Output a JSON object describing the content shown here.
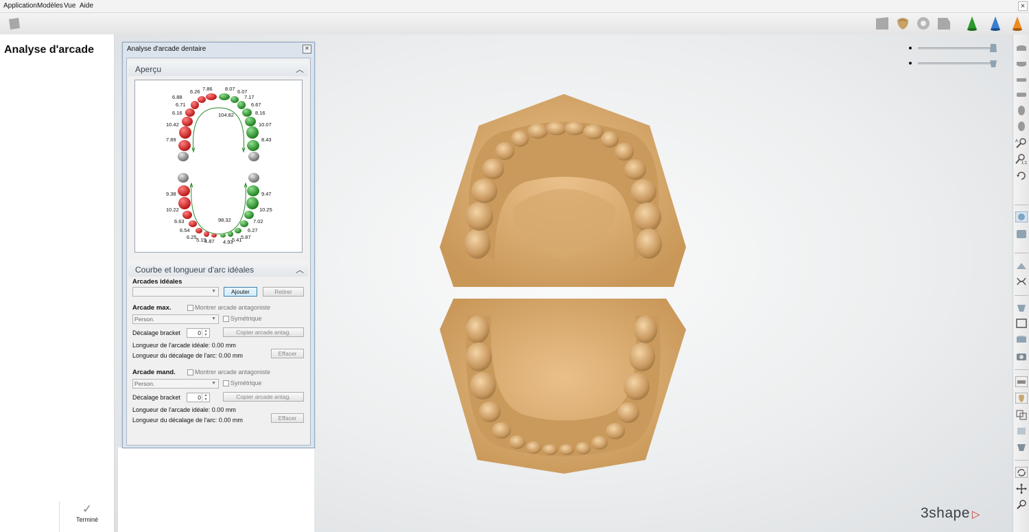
{
  "menu": {
    "items": [
      "Application",
      "Modèles",
      "Vue",
      "Aide"
    ]
  },
  "left_panel": {
    "title": "Analyse d'arcade",
    "done_label": "Terminé"
  },
  "dialog": {
    "title": "Analyse d'arcade dentaire",
    "preview": {
      "header": "Aperçu",
      "upper_arch_length": "104.82",
      "lower_arch_length": "98.32",
      "upper_left_values": [
        "7.86",
        "6.26",
        "6.88",
        "6.71",
        "6.16",
        "10.42",
        "7.89"
      ],
      "upper_right_values": [
        "8.07",
        "6.07",
        "7.17",
        "6.67",
        "8.16",
        "10.07",
        "8.43"
      ],
      "lower_left_values": [
        "9.38",
        "10.22",
        "6.63",
        "6.54",
        "6.25",
        "5.19",
        "4.87"
      ],
      "lower_right_values": [
        "9.47",
        "10.25",
        "7.02",
        "6.27",
        "5.87",
        "5.41",
        "4.93"
      ]
    },
    "ideal": {
      "header": "Courbe et longueur d'arc idéales",
      "ideal_arches_label": "Arcades idéales",
      "ideal_arch_value": "",
      "add_button": "Ajouter",
      "remove_button": "Retirer",
      "max": {
        "label": "Arcade max.",
        "show_antagonist": "Montrer arcade antagoniste",
        "type_value": "Person.",
        "symmetric": "Symétrique",
        "bracket_label": "Décalage bracket",
        "bracket_value": "0",
        "copy_button": "Copier arcade antag.",
        "ideal_length": "Longueur de l'arcade idéale: 0.00 mm",
        "offset_length": "Longueur du décalage de l'arc: 0.00 mm",
        "clear_button": "Effacer"
      },
      "mand": {
        "label": "Arcade mand.",
        "show_antagonist": "Montrer arcade antagoniste",
        "type_value": "Person.",
        "symmetric": "Symétrique",
        "bracket_label": "Décalage bracket",
        "bracket_value": "0",
        "copy_button": "Copier arcade antag.",
        "ideal_length": "Longueur de l'arcade idéale: 0.00 mm",
        "offset_length": "Longueur du décalage de l'arc: 0.00 mm",
        "clear_button": "Effacer"
      }
    }
  },
  "brand": "3shape",
  "colors": {
    "model": "#d9a96b",
    "tooth_red": "#d22a2a",
    "tooth_green": "#2f9a2f",
    "tooth_grey": "#8c8c8c",
    "accent": "#3c7fb1"
  }
}
